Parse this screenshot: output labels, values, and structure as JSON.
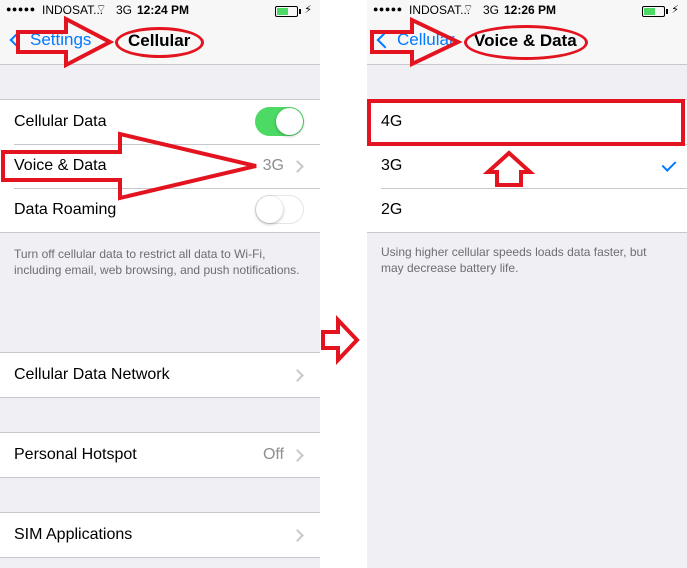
{
  "left": {
    "status": {
      "carrier": "INDOSAT...",
      "network": "3G",
      "time": "12:24 PM"
    },
    "nav": {
      "back_label": "Settings",
      "title": "Cellular"
    },
    "group1": [
      {
        "label": "Cellular Data",
        "toggle": "on"
      },
      {
        "label": "Voice & Data",
        "value": "3G"
      },
      {
        "label": "Data Roaming",
        "toggle": "off"
      }
    ],
    "footer": "Turn off cellular data to restrict all data to Wi-Fi, including email, web browsing, and push notifications.",
    "network_row": {
      "label": "Cellular Data Network"
    },
    "hotspot_row": {
      "label": "Personal Hotspot",
      "value": "Off"
    },
    "sim_row": {
      "label": "SIM Applications"
    }
  },
  "right": {
    "status": {
      "carrier": "INDOSAT...",
      "network": "3G",
      "time": "12:26 PM"
    },
    "nav": {
      "back_label": "Cellular",
      "title": "Voice & Data"
    },
    "options": [
      {
        "label": "4G",
        "selected": false
      },
      {
        "label": "3G",
        "selected": true
      },
      {
        "label": "2G",
        "selected": false
      }
    ],
    "footer": "Using higher cellular speeds loads data faster, but may decrease battery life."
  },
  "colors": {
    "annotation": "#e3141f",
    "accent": "#007aff",
    "toggle_on": "#4cd964"
  },
  "battery_level": 0.6
}
